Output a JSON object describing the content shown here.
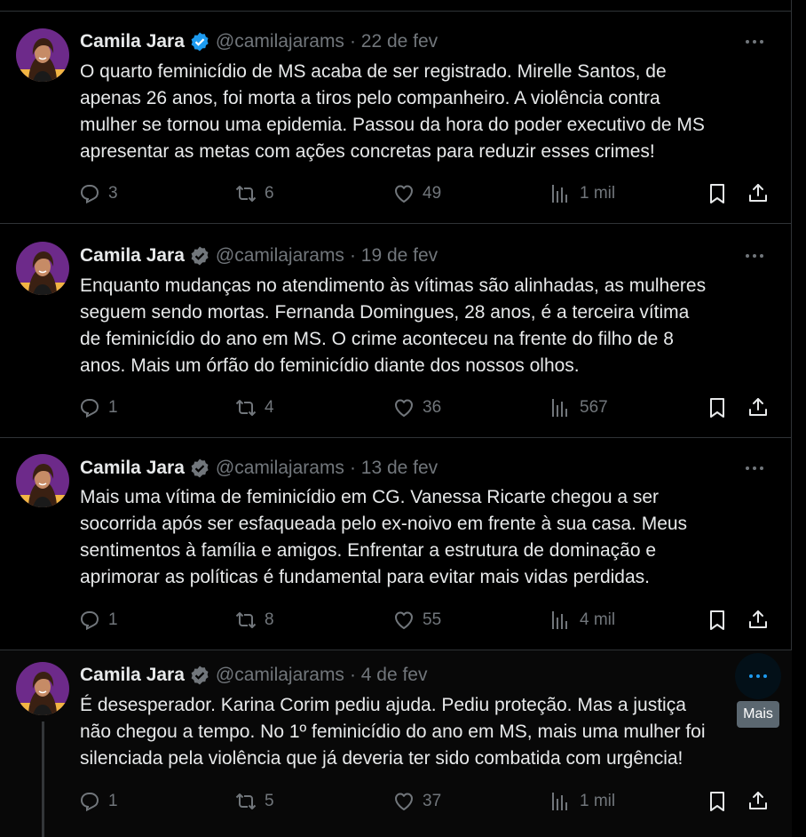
{
  "colors": {
    "background": "#000000",
    "text": "#e7e9ea",
    "secondary": "#71767b",
    "accent": "#1d9bf0",
    "tooltip_bg": "#5b6770"
  },
  "icons": {
    "reply": "reply-icon",
    "repost": "repost-icon",
    "like": "heart-icon",
    "views": "views-icon",
    "bookmark": "bookmark-icon",
    "share": "share-icon",
    "more": "more-icon",
    "verified": "verified-badge-icon"
  },
  "tooltip": "Mais",
  "tweets": [
    {
      "name": "Camila Jara",
      "handle": "@camilajarams",
      "date": "· 22 de fev",
      "lines": [
        "O quarto feminicídio de MS acaba de ser registrado. Mirelle Santos, de",
        "apenas 26 anos, foi morta a tiros pelo companheiro. A violência contra",
        "mulher se tornou uma epidemia. Passou da hora do poder executivo de MS",
        "apresentar as metas com ações concretas para reduzir esses crimes!"
      ],
      "replies": "3",
      "reposts": "6",
      "likes": "49",
      "views": "1 mil"
    },
    {
      "name": "Camila Jara",
      "handle": "@camilajarams",
      "date": "· 19 de fev",
      "lines": [
        "Enquanto mudanças no atendimento às vítimas são alinhadas, as mulheres",
        "seguem sendo mortas. Fernanda Domingues, 28 anos, é a terceira vítima",
        "de feminicídio do ano em MS. O crime aconteceu na frente do filho de 8",
        "anos. Mais um órfão do feminicídio diante dos nossos olhos."
      ],
      "replies": "1",
      "reposts": "4",
      "likes": "36",
      "views": "567"
    },
    {
      "name": "Camila Jara",
      "handle": "@camilajarams",
      "date": "· 13 de fev",
      "lines": [
        "Mais uma vítima de feminicídio em CG. Vanessa Ricarte chegou a ser",
        "socorrida após ser esfaqueada pelo ex-noivo em frente à sua casa. Meus",
        "sentimentos à família e amigos. Enfrentar a estrutura de dominação e",
        "aprimorar as políticas é fundamental para evitar mais vidas perdidas."
      ],
      "replies": "1",
      "reposts": "8",
      "likes": "55",
      "views": "4 mil"
    },
    {
      "name": "Camila Jara",
      "handle": "@camilajarams",
      "date": "· 4 de fev",
      "lines": [
        "É desesperador. Karina Corim pediu ajuda. Pediu proteção. Mas a justiça",
        "não chegou a tempo. No 1º feminicídio do ano em MS, mais uma mulher foi",
        "silenciada pela violência que já deveria ter sido combatida com urgência!"
      ],
      "replies": "1",
      "reposts": "5",
      "likes": "37",
      "views": "1 mil"
    }
  ]
}
